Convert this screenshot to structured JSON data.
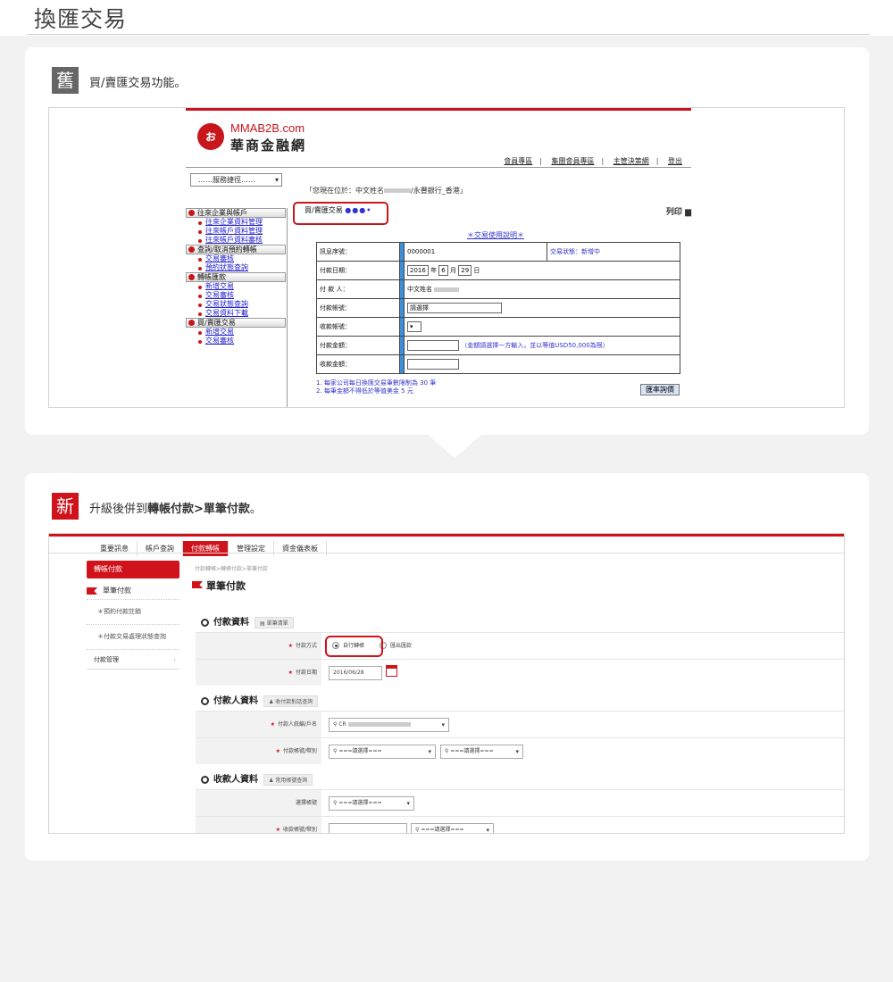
{
  "page_title": "換匯交易",
  "old": {
    "badge": "舊",
    "caption": "買/賣匯交易功能。",
    "brand_en": "MMAB2B.com",
    "brand_zh": "華商金融網",
    "logo": "ぉ",
    "top_links": [
      "會員專區",
      "集團會員專區",
      "主管決策網",
      "登出"
    ],
    "service_select": "……服務捷徑……",
    "location": "「您現在位於：中文姓名",
    "location_tail": "/永豐銀行_香港」",
    "tab_title": "買/賣匯交易",
    "tab_dots": "●●●•",
    "print": "列印",
    "help_link": "＊交易使用說明＊",
    "sidebar": [
      {
        "section": "往來企業與帳戶",
        "items": [
          "往來企業資料管理",
          "往來帳戶資料管理",
          "往來帳戶資料審核"
        ]
      },
      {
        "section": "查詢/取消預約轉帳",
        "items": [
          "交易審核",
          "預約狀態查詢"
        ]
      },
      {
        "section": "轉帳匯款",
        "items": [
          "新增交易",
          "交易審核",
          "交易狀態查詢",
          "交易資料下載"
        ]
      },
      {
        "section": "買/賣匯交易",
        "items": [
          "新增交易",
          "交易審核"
        ]
      }
    ],
    "form": {
      "serial_label": "訊息序號：",
      "serial_value": "0000001",
      "status": "交易狀態：新增中",
      "paydate_label": "付款日期：",
      "year": "2016",
      "year_unit": "年",
      "month": "6",
      "month_unit": "月",
      "day": "29",
      "day_unit": "日",
      "payer_label": "付 款 人：",
      "payer_value": "中文姓名",
      "payacct_label": "付款帳號：",
      "payacct_value": "請選擇",
      "recvacct_label": "收款帳號：",
      "payamt_label": "付款金額：",
      "payamt_note": "（金額請選擇一方輸入，並以等值USD50,000為限）",
      "recvamt_label": "收款金額："
    },
    "notes": [
      "1. 每家公司每日換匯交易筆數限制為 30 筆",
      "2. 每筆金額不得低於等值美金 5 元"
    ],
    "rate_button": "匯率詢價"
  },
  "new": {
    "badge": "新",
    "caption_pre": "升級後併到",
    "caption_bold": "轉帳付款>單筆付款",
    "caption_post": "。",
    "tabs": [
      "重要訊息",
      "帳戶查詢",
      "付款轉帳",
      "管理設定",
      "資金儀表板"
    ],
    "active_tab": 2,
    "side_head": "轉帳付款",
    "side_current": "單筆付款",
    "side_sub": [
      "＊預約付款註銷",
      "＊付款交易處理狀態查詢"
    ],
    "side_mgr": "付款管理",
    "breadcrumb": "付款轉帳>轉帳付款>單筆付款",
    "page_heading": "單筆付款",
    "sections": {
      "payment": "付款資料",
      "payment_chip": "單筆清單",
      "payer": "付款人資料",
      "payer_chip": "收付款對話查詢",
      "payee": "收款人資料",
      "payee_chip": "常用帳號查詢"
    },
    "fields": {
      "method_label": "付款方式",
      "method_opt1": "自行轉帳",
      "method_opt2": "匯出匯款",
      "date_label": "付款日期",
      "date_value": "2016/06/28",
      "payer_id_label": "付款人統編/戶名",
      "payer_id_value": "CR",
      "payer_acct_label": "付款帳號/幣別",
      "select_placeholder": "===請選擇===",
      "payee_select_label": "選擇帳號",
      "payee_acct_label": "收款帳號/幣別"
    }
  }
}
